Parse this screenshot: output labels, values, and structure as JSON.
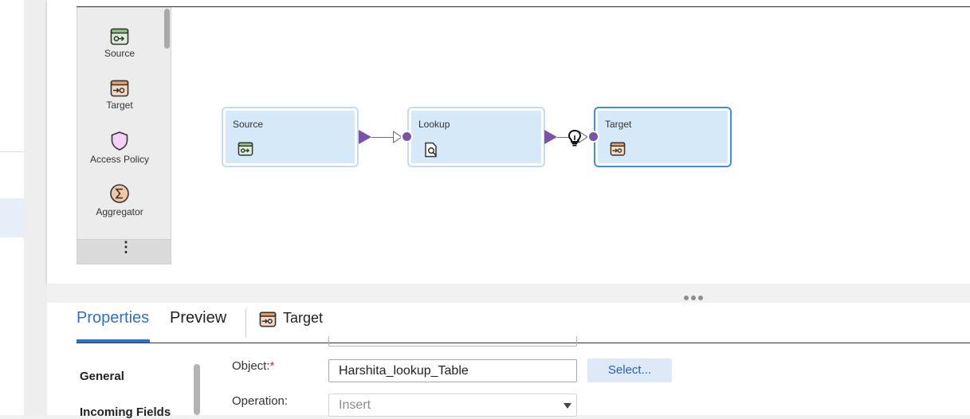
{
  "palette": {
    "items": [
      {
        "label": "Source",
        "icon": "source-icon"
      },
      {
        "label": "Target",
        "icon": "target-icon"
      },
      {
        "label": "Access Policy",
        "icon": "shield-icon"
      },
      {
        "label": "Aggregator",
        "icon": "sigma-icon"
      }
    ],
    "more_label": "⋮"
  },
  "canvas": {
    "nodes": [
      {
        "title": "Source",
        "icon": "source-icon",
        "selected": false
      },
      {
        "title": "Lookup",
        "icon": "lookup-icon",
        "selected": false
      },
      {
        "title": "Target",
        "icon": "target-icon",
        "selected": true
      }
    ],
    "hint_icon": "lightbulb-icon"
  },
  "colors": {
    "accent": "#2f6fd3",
    "port": "#7a52a8",
    "node_fill": "#d6e9f8",
    "selected_border": "#3d8fe0",
    "required": "#d32f2f"
  },
  "properties": {
    "tabs": [
      "Properties",
      "Preview"
    ],
    "active_tab": "Properties",
    "selected_object": "Target",
    "nav": [
      "General",
      "Incoming Fields"
    ],
    "object_label": "Object:",
    "object_required_mark": "*",
    "object_value": "Harshita_lookup_Table",
    "select_button": "Select...",
    "operation_label": "Operation:",
    "operation_value": "Insert"
  }
}
